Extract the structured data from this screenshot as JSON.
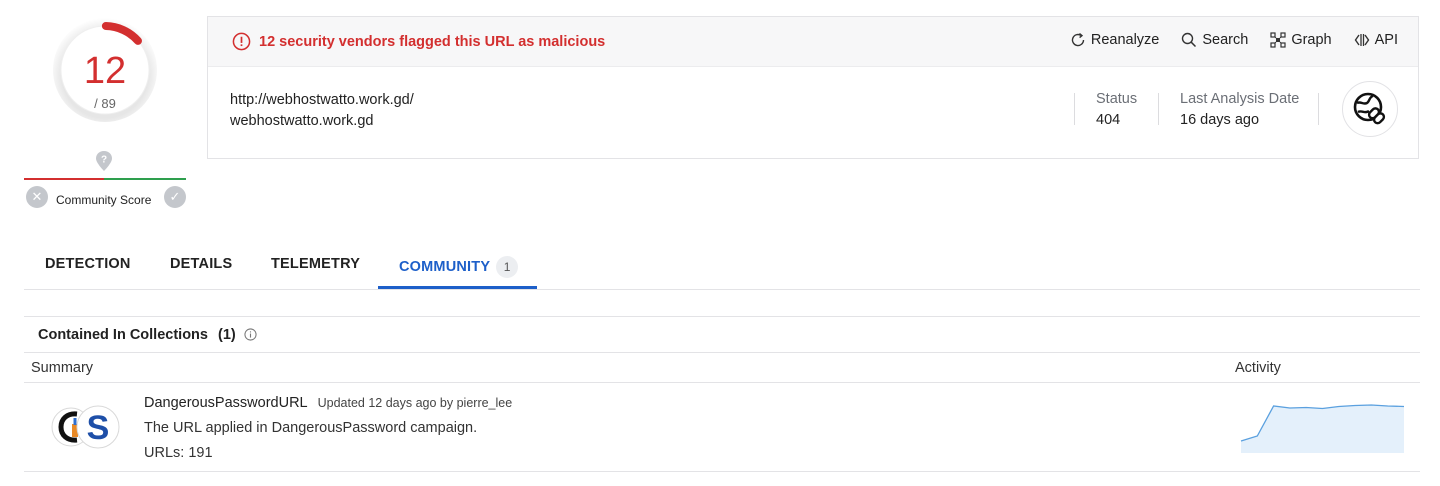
{
  "score": {
    "detections": "12",
    "total": "/ 89",
    "detection_fraction": 0.1348,
    "gauge_color": "#d32f2f"
  },
  "community": {
    "label": "Community Score",
    "question_icon": "question-marker-icon",
    "downvote_icon": "x-icon",
    "upvote_icon": "check-icon"
  },
  "alert": {
    "text": "12 security vendors flagged this URL as malicious",
    "icon": "alert-circle-icon",
    "color": "#d32f2f"
  },
  "actions": [
    {
      "label": "Reanalyze",
      "icon": "refresh-icon"
    },
    {
      "label": "Search",
      "icon": "search-icon"
    },
    {
      "label": "Graph",
      "icon": "graph-icon"
    },
    {
      "label": "API",
      "icon": "api-icon"
    }
  ],
  "target": {
    "url": "http://webhostwatto.work.gd/",
    "host": "webhostwatto.work.gd"
  },
  "status": {
    "label": "Status",
    "value": "404"
  },
  "last_analysis": {
    "label": "Last Analysis Date",
    "value": "16 days ago"
  },
  "url_type_icon": "globe-link-icon",
  "tabs": [
    {
      "label": "DETECTION"
    },
    {
      "label": "DETAILS"
    },
    {
      "label": "TELEMETRY"
    },
    {
      "label": "COMMUNITY",
      "badge": "1",
      "active": true
    }
  ],
  "accent_color": "#1d5fc9",
  "collections": {
    "title": "Contained In Collections",
    "count": "(1)",
    "info_icon": "info-icon",
    "columns": {
      "summary": "Summary",
      "activity": "Activity"
    },
    "items": [
      {
        "name": "DangerousPasswordURL",
        "updated": "Updated 12 days ago by pierre_lee",
        "description": "The URL applied in DangerousPassword campaign.",
        "urls": "URLs: 191",
        "logo_icon": "collection-logo-icon",
        "activity": [
          2,
          3,
          9,
          8.6,
          8.7,
          8.5,
          8.9,
          9.1,
          9.2,
          9,
          8.9
        ]
      }
    ]
  }
}
